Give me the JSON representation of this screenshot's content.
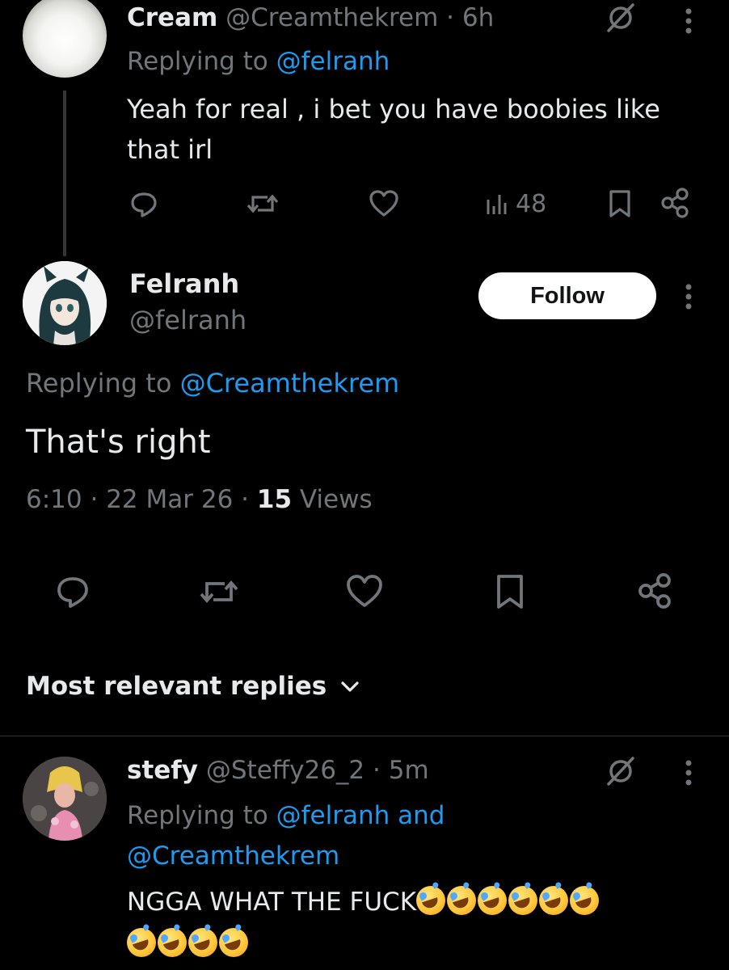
{
  "parent_tweet": {
    "display_name": "Cream",
    "handle": "@Creamthekrem",
    "separator": "·",
    "time": "6h",
    "replying_prefix": "Replying to",
    "replying_to": "@felranh",
    "text_line1": "Yeah for real , i bet you have boobies like",
    "text_line2": "that irl",
    "views_count": "48"
  },
  "main_tweet": {
    "display_name": "Felranh",
    "handle": "@felranh",
    "follow_label": "Follow",
    "replying_prefix": "Replying to",
    "replying_to": "@Creamthekrem",
    "text": "That's right",
    "time": "6:10",
    "sep1": "·",
    "date": "22 Mar 26",
    "sep2": "·",
    "views_number": "15",
    "views_label": "Views"
  },
  "replies_sort": {
    "label": "Most relevant replies"
  },
  "reply_tweet": {
    "display_name": "stefy",
    "handle": "@Steffy26_2",
    "separator": "·",
    "time": "5m",
    "replying_prefix": "Replying to",
    "replying_to_1": "@felranh",
    "and_word": "and",
    "replying_to_2": "@Creamthekrem",
    "text": "NGGA WHAT THE FUCK",
    "emoji_name": "rolling-on-the-floor-laughing"
  },
  "icons": {
    "reply": "reply-icon",
    "retweet": "retweet-icon",
    "like": "heart-icon",
    "views": "views-chart-icon",
    "bookmark": "bookmark-icon",
    "share": "share-icon",
    "grok": "grok-icon",
    "more": "more-vertical-icon",
    "chevron": "chevron-down-icon"
  },
  "colors": {
    "background": "#000000",
    "primary_text": "#e7e9ea",
    "secondary_text": "#71767b",
    "link": "#1d9bf0",
    "follow_bg": "#ffffff"
  }
}
